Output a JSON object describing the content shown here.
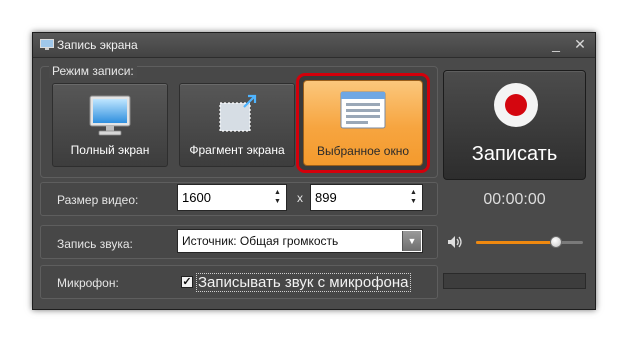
{
  "window": {
    "title": "Запись экрана",
    "minimize_glyph": "_",
    "close_glyph": "✕"
  },
  "mode": {
    "group_label": "Режим записи:",
    "options": [
      {
        "label": "Полный экран",
        "icon": "monitor-icon",
        "selected": false
      },
      {
        "label": "Фрагмент экрана",
        "icon": "fragment-icon",
        "selected": false
      },
      {
        "label": "Выбранное окно",
        "icon": "window-icon",
        "selected": true
      }
    ]
  },
  "record": {
    "label": "Записать",
    "icon": "record-icon",
    "timer": "00:00:00"
  },
  "video_size": {
    "label": "Размер видео:",
    "width": "1600",
    "separator": "x",
    "height": "899"
  },
  "audio": {
    "label": "Запись звука:",
    "source": "Источник: Общая громкость",
    "volume_level": 0.75
  },
  "microphone": {
    "label": "Микрофон:",
    "checkbox_label": "Записывать звук с микрофона",
    "checked": true
  },
  "colors": {
    "window_bg": "#4a4a4a",
    "accent_orange": "#f0890f",
    "record_red": "#d4060f",
    "highlight_red": "#d3000b"
  }
}
